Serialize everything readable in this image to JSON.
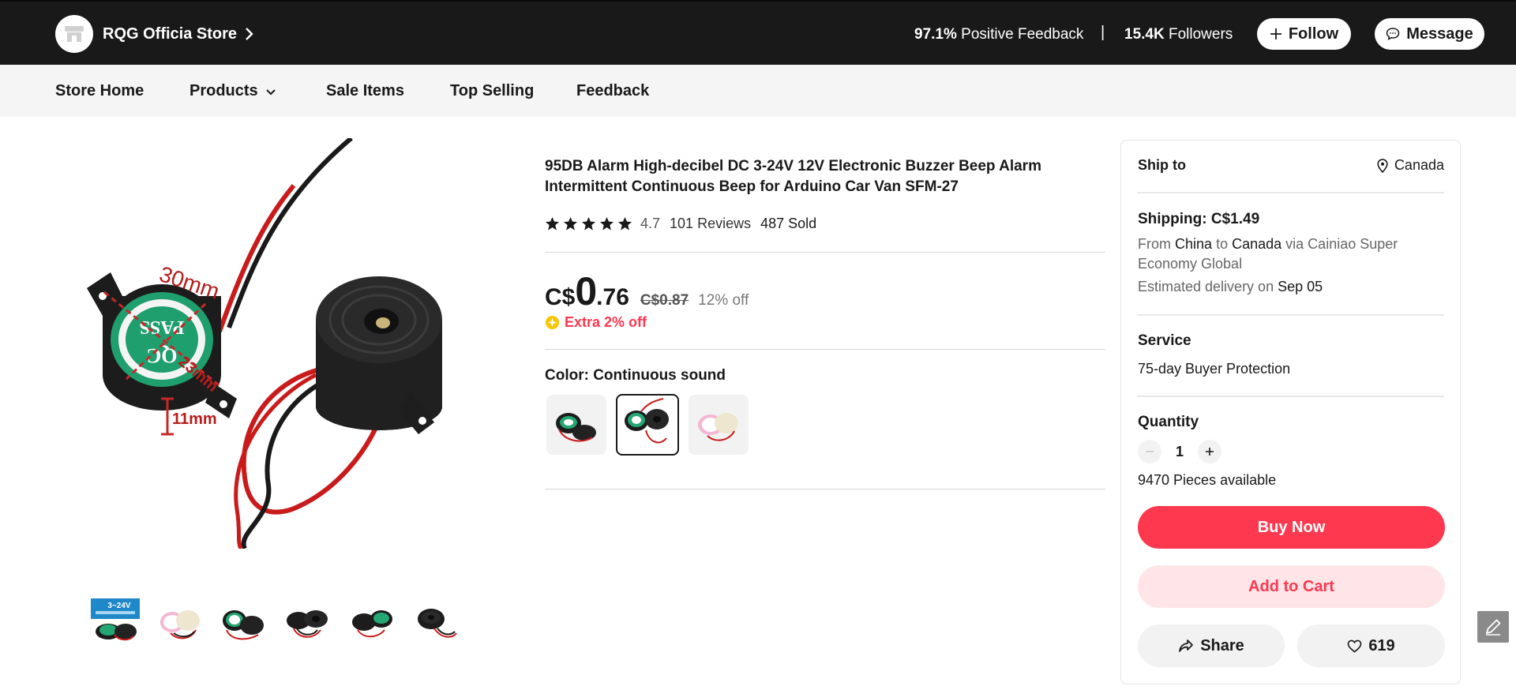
{
  "store": {
    "name": "RQG Officia Store",
    "feedback_percent": "97.1%",
    "feedback_label": "Positive Feedback",
    "separator": "|",
    "followers_count": "15.4K",
    "followers_label": "Followers",
    "follow_label": "Follow",
    "message_label": "Message"
  },
  "nav": {
    "items": [
      {
        "label": "Store Home"
      },
      {
        "label": "Products"
      },
      {
        "label": "Sale Items"
      },
      {
        "label": "Top Selling"
      },
      {
        "label": "Feedback"
      }
    ]
  },
  "gallery": {
    "main_image_labels": {
      "diameter": "30mm",
      "inner": "23mm",
      "height": "11mm",
      "sticker_line1": "PASS",
      "sticker_line2": "QC"
    },
    "thumbnail_count": 6,
    "first_thumb_badge": "3~24V"
  },
  "product": {
    "title": "95DB Alarm High-decibel DC 3-24V 12V Electronic Buzzer Beep Alarm Intermittent Continuous Beep for Arduino Car Van SFM-27",
    "rating": "4.7",
    "rating_stars": 5,
    "reviews": "101 Reviews",
    "sold": "487 Sold",
    "currency": "C$",
    "price_int": "0",
    "price_dec": ".76",
    "old_price": "C$0.87",
    "discount": "12% off",
    "extra_discount": "Extra 2% off",
    "color_label": "Color: Continuous sound",
    "swatches": [
      {
        "selected": false
      },
      {
        "selected": true
      },
      {
        "selected": false
      }
    ]
  },
  "panel": {
    "ship_to_label": "Ship to",
    "ship_to_country": "Canada",
    "shipping_fee": "Shipping: C$1.49",
    "route_from": "From",
    "route_origin": "China",
    "route_to": "to",
    "route_dest": "Canada",
    "route_via": "via Cainiao Super Economy Global",
    "delivery_label": "Estimated delivery on",
    "delivery_date": "Sep 05",
    "service_label": "Service",
    "service_value": "75-day Buyer Protection",
    "quantity_label": "Quantity",
    "quantity_value": "1",
    "available": "9470 Pieces available",
    "buy_now": "Buy Now",
    "add_to_cart": "Add to Cart",
    "share": "Share",
    "wishlist_count": "619"
  },
  "colors": {
    "accent": "#fd384f",
    "accent_light": "#ffe5e8",
    "dark_bar": "#191919",
    "nav_bg": "#f5f5f5",
    "coin": "#f7c600"
  },
  "icons": {
    "store_logo": "store-icon",
    "store_chevron": "chevron-right-icon",
    "follow": "plus-icon",
    "message": "chat-bubble-icon",
    "products_dropdown": "chevron-down-icon",
    "star": "star-icon",
    "coin": "coin-icon",
    "location": "location-pin-icon",
    "share": "share-arrow-icon",
    "wishlist": "heart-icon",
    "edit": "pencil-icon"
  }
}
